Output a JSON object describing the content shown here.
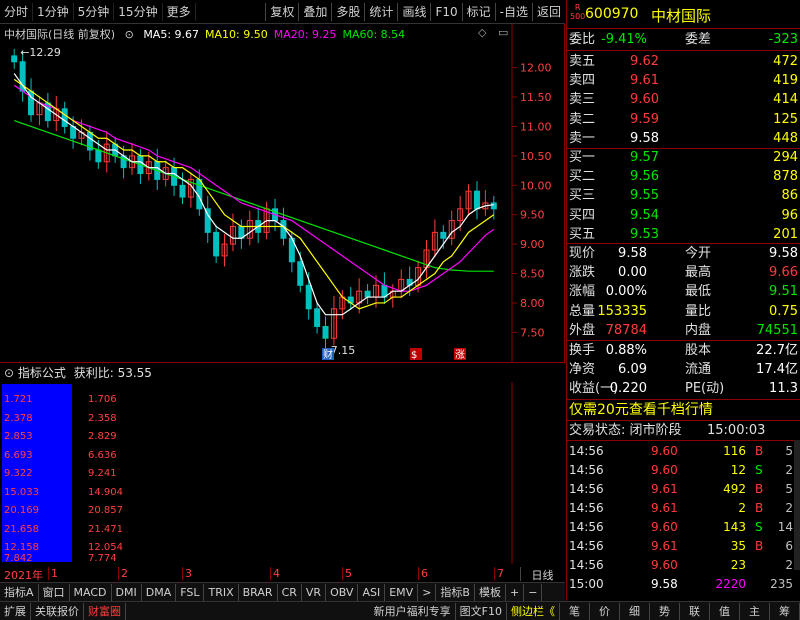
{
  "toolbar": {
    "left": [
      "分时",
      "1分钟",
      "5分钟",
      "15分钟",
      "更多"
    ],
    "right": [
      "复权",
      "叠加",
      "多股",
      "统计",
      "画线",
      "F10",
      "标记",
      "-自选",
      "返回"
    ]
  },
  "chart": {
    "title": "中材国际(日线 前复权)",
    "ma": [
      {
        "label": "MA5: 9.67",
        "color": "#ffffff"
      },
      {
        "label": "MA10: 9.50",
        "color": "#ffff00"
      },
      {
        "label": "MA20: 9.25",
        "color": "#ff00ff"
      },
      {
        "label": "MA60: 8.54",
        "color": "#00e600"
      }
    ],
    "price_axis": [
      "12.00",
      "11.50",
      "11.00",
      "10.50",
      "10.00",
      "9.50",
      "9.00",
      "8.50",
      "8.00",
      "7.50"
    ],
    "high_label": "12.29",
    "low_label": "7.15",
    "markers": [
      "财",
      "$",
      "涨"
    ]
  },
  "chart_data": {
    "type": "candlestick",
    "ylim": [
      7.2,
      12.3
    ],
    "close": [
      12.1,
      11.6,
      11.2,
      11.4,
      11.1,
      11.3,
      11.0,
      10.8,
      10.9,
      10.6,
      10.4,
      10.7,
      10.5,
      10.3,
      10.5,
      10.2,
      10.4,
      10.1,
      10.3,
      10.0,
      9.8,
      10.1,
      9.6,
      9.2,
      8.8,
      9.0,
      9.3,
      9.1,
      9.4,
      9.2,
      9.6,
      9.4,
      9.1,
      8.7,
      8.3,
      7.9,
      7.6,
      7.4,
      7.9,
      8.1,
      8.0,
      8.2,
      8.1,
      8.3,
      8.1,
      8.2,
      8.4,
      8.3,
      8.6,
      8.9,
      9.2,
      9.1,
      9.4,
      9.6,
      9.9,
      9.6,
      9.7,
      9.6
    ],
    "ma5": [
      11.9,
      11.7,
      11.5,
      11.4,
      11.3,
      11.2,
      11.1,
      11.0,
      10.9,
      10.8,
      10.7,
      10.6,
      10.6,
      10.5,
      10.4,
      10.4,
      10.3,
      10.3,
      10.2,
      10.2,
      10.1,
      10.0,
      9.8,
      9.5,
      9.3,
      9.2,
      9.1,
      9.1,
      9.2,
      9.3,
      9.4,
      9.4,
      9.3,
      9.1,
      8.8,
      8.4,
      8.0,
      7.8,
      7.8,
      7.8,
      7.9,
      8.0,
      8.1,
      8.1,
      8.1,
      8.2,
      8.2,
      8.3,
      8.4,
      8.6,
      8.8,
      9.0,
      9.2,
      9.3,
      9.5,
      9.6,
      9.65,
      9.67
    ],
    "ma10": [
      11.8,
      11.7,
      11.6,
      11.5,
      11.4,
      11.3,
      11.2,
      11.1,
      11.0,
      10.9,
      10.8,
      10.8,
      10.7,
      10.6,
      10.6,
      10.5,
      10.5,
      10.4,
      10.4,
      10.3,
      10.3,
      10.2,
      10.1,
      9.9,
      9.7,
      9.5,
      9.4,
      9.3,
      9.3,
      9.3,
      9.3,
      9.3,
      9.3,
      9.2,
      9.1,
      8.9,
      8.7,
      8.5,
      8.3,
      8.1,
      8.0,
      7.9,
      7.95,
      8.0,
      8.0,
      8.1,
      8.1,
      8.2,
      8.3,
      8.4,
      8.5,
      8.7,
      8.8,
      9.0,
      9.2,
      9.3,
      9.4,
      9.5
    ],
    "ma20": [
      11.7,
      11.6,
      11.5,
      11.4,
      11.35,
      11.3,
      11.2,
      11.1,
      11.05,
      11.0,
      10.95,
      10.9,
      10.8,
      10.75,
      10.7,
      10.65,
      10.6,
      10.5,
      10.45,
      10.4,
      10.35,
      10.3,
      10.2,
      10.1,
      10.0,
      9.9,
      9.8,
      9.7,
      9.65,
      9.6,
      9.55,
      9.5,
      9.45,
      9.4,
      9.3,
      9.2,
      9.1,
      9.0,
      8.9,
      8.8,
      8.7,
      8.6,
      8.5,
      8.4,
      8.3,
      8.25,
      8.2,
      8.2,
      8.25,
      8.3,
      8.4,
      8.5,
      8.6,
      8.7,
      8.85,
      9.0,
      9.15,
      9.25
    ],
    "ma60": [
      11.1,
      11.05,
      11.0,
      10.95,
      10.9,
      10.85,
      10.8,
      10.75,
      10.7,
      10.65,
      10.6,
      10.55,
      10.5,
      10.45,
      10.4,
      10.35,
      10.3,
      10.25,
      10.2,
      10.15,
      10.1,
      10.05,
      10.0,
      9.95,
      9.9,
      9.85,
      9.8,
      9.75,
      9.7,
      9.65,
      9.6,
      9.55,
      9.5,
      9.45,
      9.4,
      9.35,
      9.3,
      9.25,
      9.2,
      9.15,
      9.1,
      9.05,
      9.0,
      8.95,
      8.9,
      8.85,
      8.8,
      8.75,
      8.7,
      8.65,
      8.6,
      8.58,
      8.56,
      8.55,
      8.54,
      8.54,
      8.54,
      8.54
    ]
  },
  "indicator": {
    "name": "指标公式",
    "label": "获利比: 53.55",
    "rows": [
      [
        "1.721",
        "1.706"
      ],
      [
        "2.378",
        "2.358"
      ],
      [
        "2.853",
        "2.829"
      ],
      [
        "6.693",
        "6.636"
      ],
      [
        "9.322",
        "9.241"
      ],
      [
        "15.033",
        "14.904"
      ],
      [
        "20.169",
        "20.857"
      ],
      [
        "21.658",
        "21.471"
      ],
      [
        "12.158",
        "12.054"
      ],
      [
        "7.842",
        "7.774"
      ]
    ]
  },
  "xaxis": {
    "year": "2021年",
    "months": [
      "1",
      "2",
      "3",
      "4",
      "5",
      "6",
      "7"
    ],
    "period": "日线"
  },
  "bottom_tabs": [
    "指标A",
    "窗口",
    "MACD",
    "DMI",
    "DMA",
    "FSL",
    "TRIX",
    "BRAR",
    "CR",
    "VR",
    "OBV",
    "ASI",
    "EMV",
    ">",
    "指标B",
    "模板",
    "+",
    "−"
  ],
  "status_bar": {
    "left": [
      "扩展",
      "关联报价",
      "财富圈"
    ],
    "mid": [
      "新用户福利专享",
      "图文F10",
      "侧边栏《"
    ],
    "right": [
      "笔",
      "价",
      "细",
      "势",
      "联",
      "值",
      "主",
      "筹"
    ]
  },
  "stock": {
    "code": "600970",
    "name": "中材国际",
    "badge_top": "R",
    "badge_bottom": "500"
  },
  "weibi": {
    "l1": "委比",
    "v1": "-9.41%",
    "l2": "委差",
    "v2": "-323"
  },
  "asks": [
    {
      "label": "卖五",
      "price": "9.62",
      "vol": "472"
    },
    {
      "label": "卖四",
      "price": "9.61",
      "vol": "419"
    },
    {
      "label": "卖三",
      "price": "9.60",
      "vol": "414"
    },
    {
      "label": "卖二",
      "price": "9.59",
      "vol": "125"
    },
    {
      "label": "卖一",
      "price": "9.58",
      "vol": "448"
    }
  ],
  "bids": [
    {
      "label": "买一",
      "price": "9.57",
      "vol": "294"
    },
    {
      "label": "买二",
      "price": "9.56",
      "vol": "878"
    },
    {
      "label": "买三",
      "price": "9.55",
      "vol": "86"
    },
    {
      "label": "买四",
      "price": "9.54",
      "vol": "96"
    },
    {
      "label": "买五",
      "price": "9.53",
      "vol": "201"
    }
  ],
  "quote": [
    {
      "l1": "现价",
      "v1": "9.58",
      "c1": "#ffffff",
      "l2": "今开",
      "v2": "9.58",
      "c2": "#ffffff"
    },
    {
      "l1": "涨跌",
      "v1": "0.00",
      "c1": "#ffffff",
      "l2": "最高",
      "v2": "9.66",
      "c2": "#ff3b3b"
    },
    {
      "l1": "涨幅",
      "v1": "0.00%",
      "c1": "#ffffff",
      "l2": "最低",
      "v2": "9.51",
      "c2": "#00e600"
    },
    {
      "l1": "总量",
      "v1": "153335",
      "c1": "#ffff00",
      "l2": "量比",
      "v2": "0.75",
      "c2": "#ffff00"
    },
    {
      "l1": "外盘",
      "v1": "78784",
      "c1": "#ff3b3b",
      "l2": "内盘",
      "v2": "74551",
      "c2": "#00e600"
    }
  ],
  "fund": [
    {
      "l1": "换手",
      "v1": "0.88%",
      "l2": "股本",
      "v2": "22.7亿"
    },
    {
      "l1": "净资",
      "v1": "6.09",
      "l2": "流通",
      "v2": "17.4亿"
    },
    {
      "l1": "收益(一)",
      "v1": "0.220",
      "l2": "PE(动)",
      "v2": "11.3"
    }
  ],
  "promo": "仅需20元查看千档行情",
  "trade_status": {
    "label": "交易状态: 闭市阶段",
    "time": "15:00:03"
  },
  "trades": [
    {
      "time": "14:56",
      "price": "9.60",
      "vol": "116",
      "side": "B",
      "extra": "5"
    },
    {
      "time": "14:56",
      "price": "9.60",
      "vol": "12",
      "side": "S",
      "extra": "2"
    },
    {
      "time": "14:56",
      "price": "9.61",
      "vol": "492",
      "side": "B",
      "extra": "5"
    },
    {
      "time": "14:56",
      "price": "9.61",
      "vol": "2",
      "side": "B",
      "extra": "2"
    },
    {
      "time": "14:56",
      "price": "9.60",
      "vol": "143",
      "side": "S",
      "extra": "14"
    },
    {
      "time": "14:56",
      "price": "9.61",
      "vol": "35",
      "side": "B",
      "extra": "6"
    },
    {
      "time": "14:56",
      "price": "9.60",
      "vol": "23",
      "side": "",
      "extra": "2"
    },
    {
      "time": "15:00",
      "price": "9.58",
      "vol": "2220",
      "side": "",
      "extra": "235"
    }
  ],
  "colors": {
    "up": "#ff3b3b",
    "down": "#00c0c0",
    "ma5": "#ffffff",
    "ma10": "#ffff00",
    "ma20": "#ff00ff",
    "ma60": "#00e600",
    "grid": "#8b0000",
    "indicator_fill": "#0000ff"
  }
}
